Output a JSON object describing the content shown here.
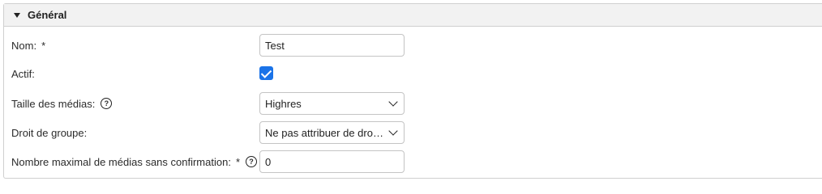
{
  "section": {
    "title": "Général"
  },
  "fields": {
    "name": {
      "label": "Nom:",
      "required_marker": "*",
      "value": "Test"
    },
    "active": {
      "label": "Actif:",
      "checked": true
    },
    "media_size": {
      "label": "Taille des médias:",
      "help_icon": "question-circle-icon",
      "value": "Highres"
    },
    "group_right": {
      "label": "Droit de groupe:",
      "value": "Ne pas attribuer de droit ..."
    },
    "max_media": {
      "label": "Nombre maximal de médias sans confirmation:",
      "required_marker": "*",
      "help_icon": "question-circle-icon",
      "value": "0"
    }
  },
  "colors": {
    "accent": "#1a73e8",
    "header_bg": "#f2f2f2",
    "border": "#cfcfcf"
  }
}
